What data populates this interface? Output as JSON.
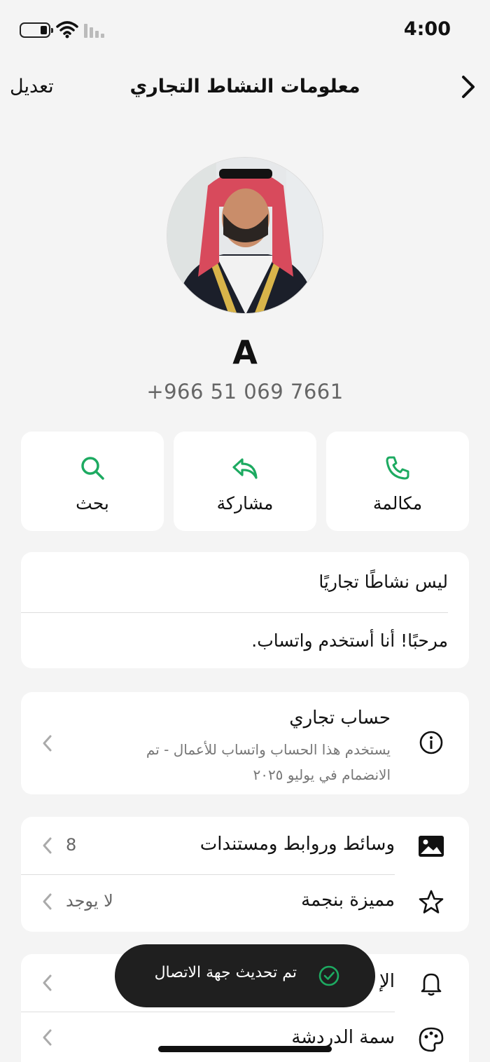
{
  "status_bar": {
    "time": "4:00"
  },
  "header": {
    "edit_label": "تعديل",
    "title": "معلومات النشاط التجاري"
  },
  "contact": {
    "name": "A",
    "phone": "+966 51 069 7661"
  },
  "actions": [
    {
      "label": "مكالمة",
      "icon": "phone-icon"
    },
    {
      "label": "مشاركة",
      "icon": "share-icon"
    },
    {
      "label": "بحث",
      "icon": "search-icon"
    }
  ],
  "about": {
    "status": "ليس نشاطًا تجاريًا",
    "text": "مرحبًا! أنا أستخدم واتساب."
  },
  "business_account": {
    "title": "حساب تجاري",
    "desc_line1": "يستخدم هذا الحساب واتساب للأعمال - تم",
    "desc_line2": "الانضمام في يوليو ٢٠٢٥"
  },
  "media": {
    "label": "وسائط وروابط ومستندات",
    "count": "8"
  },
  "starred": {
    "label": "مميزة بنجمة",
    "value": "لا يوجد"
  },
  "notifications": {
    "label_visible": "الإ"
  },
  "chat_theme": {
    "label": "سمة الدردشة"
  },
  "toast": {
    "text": "تم تحديث جهة الاتصال"
  },
  "colors": {
    "accent": "#1daa61",
    "background": "#f4f4f4",
    "toast_bg": "#1f1f1f"
  }
}
